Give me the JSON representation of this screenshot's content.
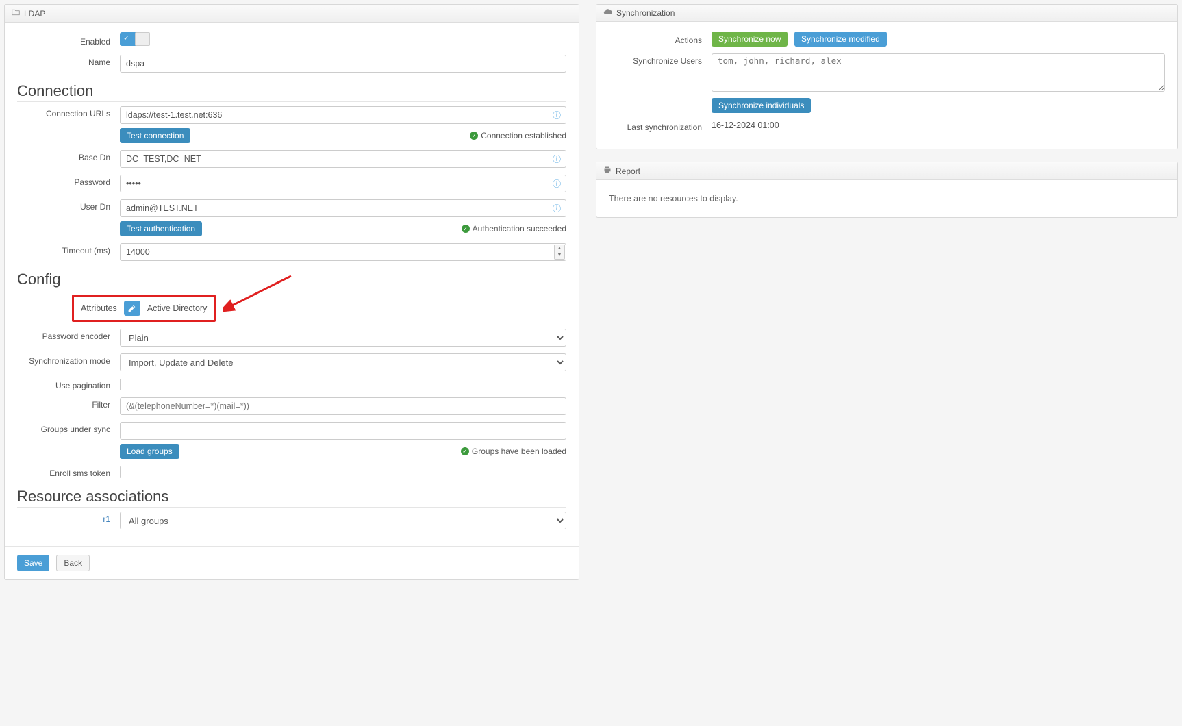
{
  "ldap": {
    "panel_title": "LDAP",
    "labels": {
      "enabled": "Enabled",
      "name": "Name",
      "connection_urls": "Connection URLs",
      "base_dn": "Base Dn",
      "password": "Password",
      "user_dn": "User Dn",
      "timeout": "Timeout (ms)",
      "attributes": "Attributes",
      "password_encoder": "Password encoder",
      "sync_mode": "Synchronization mode",
      "use_pagination": "Use pagination",
      "filter": "Filter",
      "groups_under_sync": "Groups under sync",
      "enroll_sms": "Enroll sms token",
      "resource_label": "r1"
    },
    "values": {
      "name": "dspa",
      "connection_url": "ldaps://test-1.test.net:636",
      "base_dn": "DC=TEST,DC=NET",
      "password": "•••••",
      "user_dn": "admin@TEST.NET",
      "timeout": "14000",
      "active_directory": "Active Directory",
      "password_encoder": "Plain",
      "sync_mode": "Import, Update and Delete",
      "filter_placeholder": "(&(telephoneNumber=*)(mail=*))",
      "resource_select": "All groups"
    },
    "buttons": {
      "test_connection": "Test connection",
      "test_auth": "Test authentication",
      "load_groups": "Load groups",
      "save": "Save",
      "back": "Back"
    },
    "statuses": {
      "conn_established": "Connection established",
      "auth_succeeded": "Authentication succeeded",
      "groups_loaded": "Groups have been loaded"
    },
    "sections": {
      "connection": "Connection",
      "config": "Config",
      "resource_assoc": "Resource associations"
    }
  },
  "sync": {
    "panel_title": "Synchronization",
    "labels": {
      "actions": "Actions",
      "sync_users": "Synchronize Users",
      "last_sync": "Last synchronization"
    },
    "buttons": {
      "sync_now": "Synchronize now",
      "sync_modified": "Synchronize modified",
      "sync_individuals": "Synchronize individuals"
    },
    "values": {
      "users_placeholder": "tom, john, richard, alex",
      "last_sync": "16-12-2024 01:00"
    }
  },
  "report": {
    "panel_title": "Report",
    "empty_text": "There are no resources to display."
  }
}
